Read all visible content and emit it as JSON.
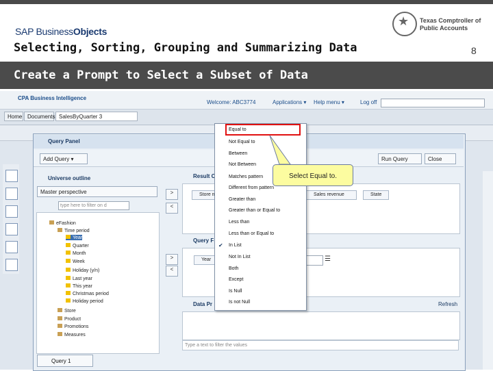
{
  "slide": {
    "logo_sap": "SAP Business",
    "logo_objects": "Objects",
    "title": "Selecting, Sorting, Grouping and Summarizing Data",
    "subtitle": "Create a Prompt to Select a Subset of Data",
    "page_number": "8",
    "comptroller_line1": "Texas Comptroller of",
    "comptroller_line2": "Public Accounts"
  },
  "app": {
    "brand": "CPA Business Intelligence",
    "welcome": "Welcome: ABC3774",
    "nav": [
      "Applications ▾",
      "Help menu ▾",
      "Log off"
    ],
    "doc_tabs": [
      "Home",
      "Documents",
      "SalesByQuarter 3"
    ]
  },
  "query_panel": {
    "title": "Query Panel",
    "add_query": "Add Query",
    "universe_outline": "Universe outline",
    "perspective": "Master perspective",
    "filter_placeholder": "type here to filter on d",
    "result_objects_title": "Result O",
    "result_chips": [
      "Store n",
      "Sales revenue",
      "State"
    ],
    "query_filters_title": "Query F",
    "filter_chip": "Year",
    "data_preview_title": "Data Pr",
    "refresh": "Refresh",
    "filter_values_placeholder": "Type a text to filter the values",
    "run_query": "Run Query",
    "close": "Close",
    "query_tab": "Query 1"
  },
  "tree": {
    "root": "eFashion",
    "items": [
      "Time period",
      "Year",
      "Quarter",
      "Month",
      "Week",
      "Holiday (y/n)",
      "Last year",
      "This year",
      "Christmas period",
      "Holiday period",
      "Store",
      "Product",
      "Promotions",
      "Measures"
    ]
  },
  "operators": {
    "items": [
      "Equal to",
      "Not Equal to",
      "Between",
      "Not Between",
      "Matches pattern",
      "Different from pattern",
      "Greater than",
      "Greater than or Equal to",
      "Less than",
      "Less than or Equal to",
      "In List",
      "Not In List",
      "Both",
      "Except",
      "Is Null",
      "Is not Null"
    ],
    "checked": "In List"
  },
  "callout": {
    "text": "Select Equal to."
  },
  "colors": {
    "accent_red": "#e01010",
    "callout_yellow": "#fcfca0",
    "header_bar": "#4b4b4b"
  }
}
